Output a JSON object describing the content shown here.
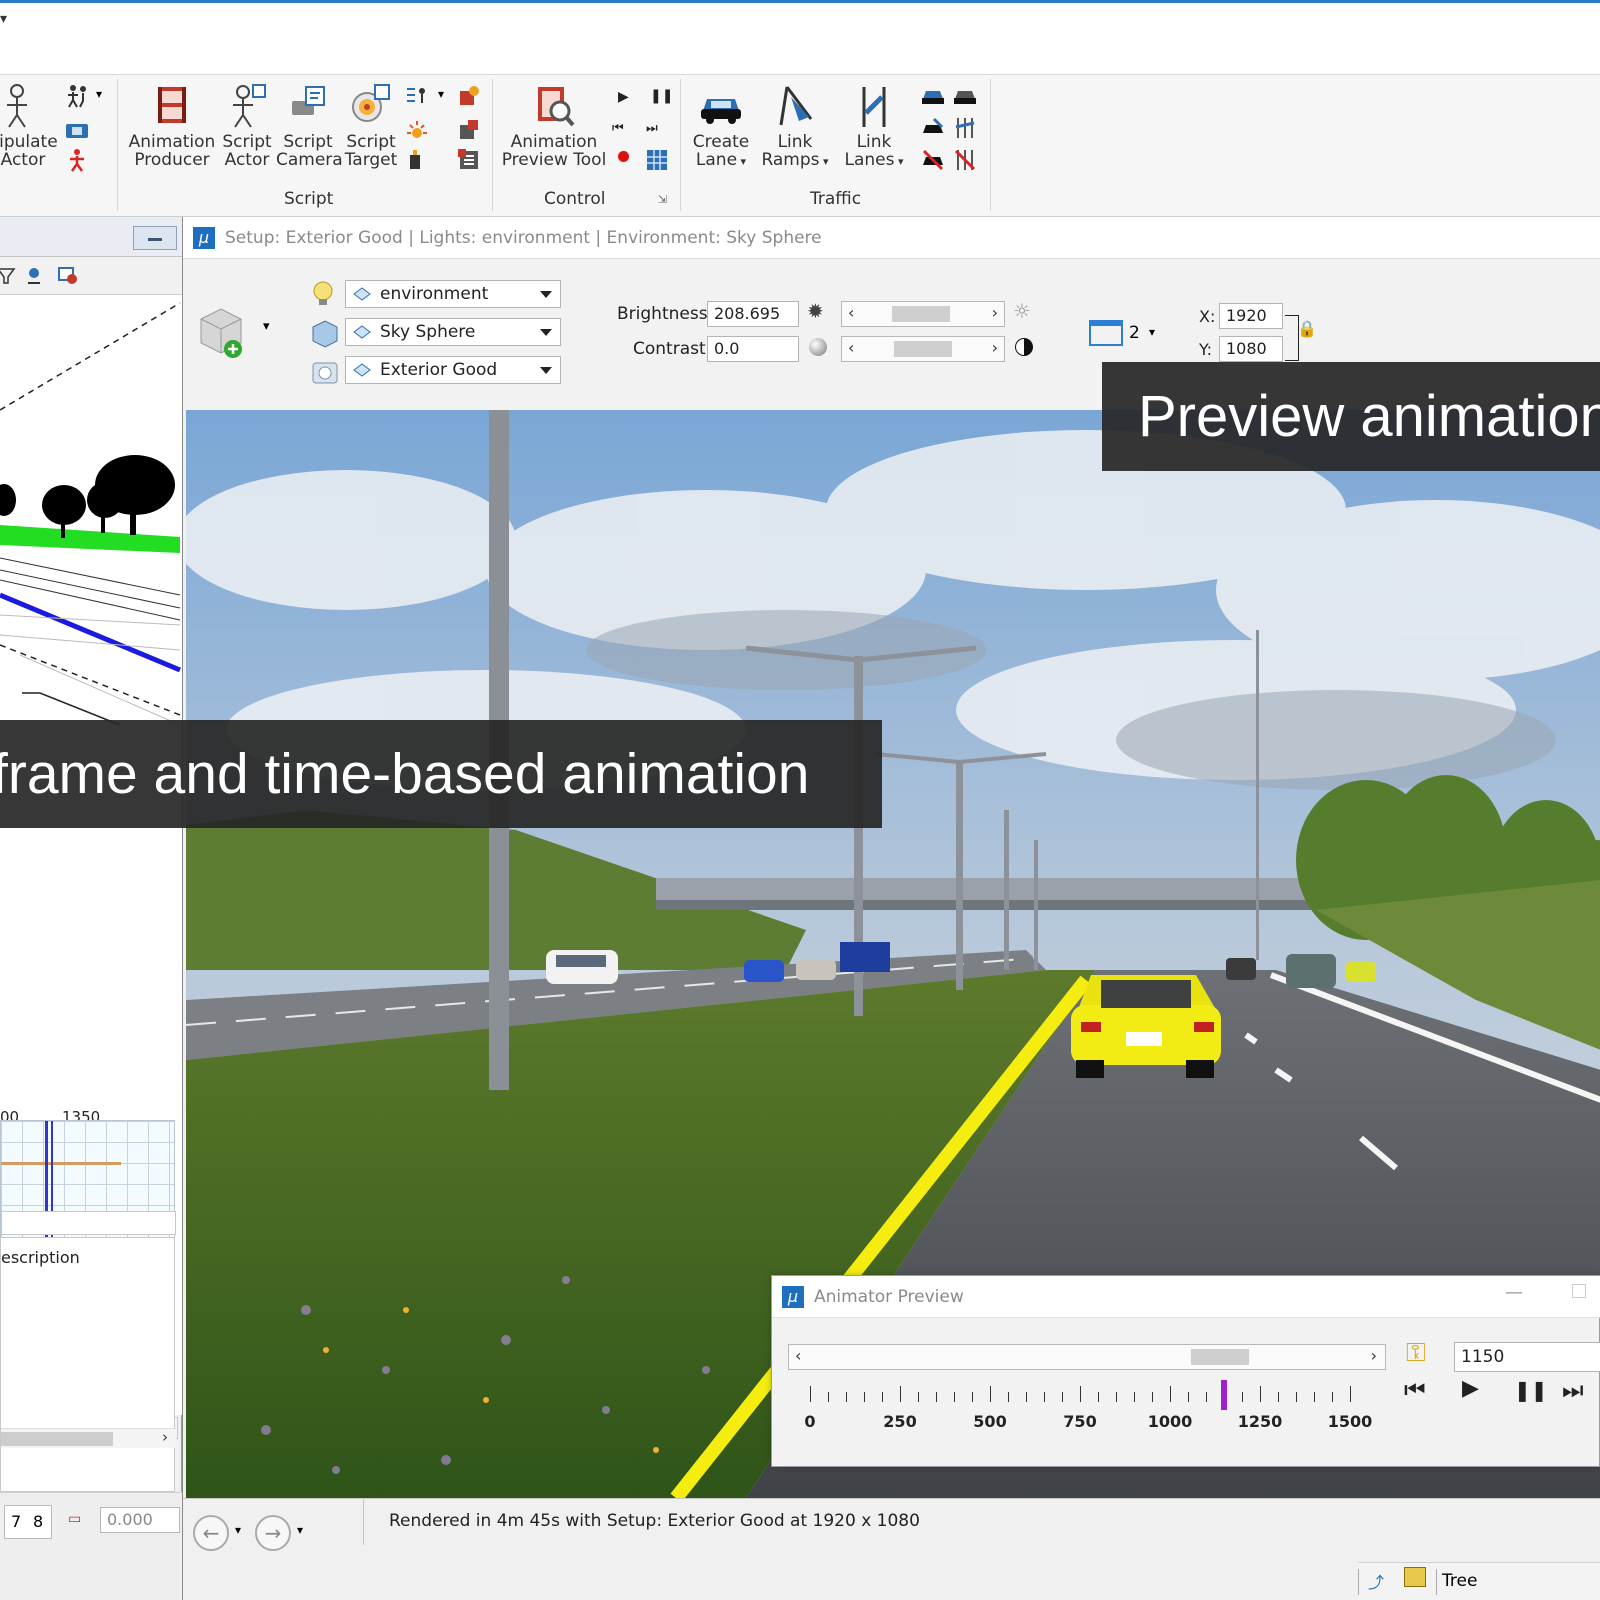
{
  "ribbon": {
    "manipulate_actor": {
      "line1": "nipulate",
      "line2": "Actor"
    },
    "script_group": {
      "label": "Script",
      "animation_producer": {
        "line1": "Animation",
        "line2": "Producer"
      },
      "script_actor": {
        "line1": "Script",
        "line2": "Actor"
      },
      "script_camera": {
        "line1": "Script",
        "line2": "Camera"
      },
      "script_target": {
        "line1": "Script",
        "line2": "Target"
      }
    },
    "control_group": {
      "label": "Control",
      "animation_preview_tool": {
        "line1": "Animation",
        "line2": "Preview Tool"
      }
    },
    "traffic_group": {
      "label": "Traffic",
      "create_lane": {
        "line1": "Create",
        "line2": "Lane"
      },
      "link_ramps": {
        "line1": "Link",
        "line2": "Ramps"
      },
      "link_lanes": {
        "line1": "Link",
        "line2": "Lanes"
      }
    }
  },
  "left_panel": {
    "timeline_labels": [
      "00",
      "1350"
    ],
    "desc_header": "escription",
    "status_tabs": [
      "7",
      "8"
    ],
    "status_value": "0.000"
  },
  "main_window": {
    "title": "Setup: Exterior Good | Lights: environment | Environment: Sky Sphere",
    "lights_dropdown": "environment",
    "environment_dropdown": "Sky Sphere",
    "setup_dropdown": "Exterior Good",
    "brightness_label": "Brightness:",
    "brightness_value": "208.695",
    "contrast_label": "Contrast:",
    "contrast_value": "0.0",
    "view_number": "2",
    "x_label": "X:",
    "x_value": "1920",
    "y_label": "Y:",
    "y_value": "1080",
    "status_text": "Rendered in 4m 45s with Setup: Exterior Good at 1920 x 1080"
  },
  "captions": {
    "top": "Preview animation",
    "middle": "frame and time-based animation"
  },
  "animator_preview": {
    "title": "Animator Preview",
    "frame_value": "1150",
    "tick_labels": [
      "0",
      "250",
      "500",
      "750",
      "1000",
      "1250",
      "1500"
    ],
    "current_frame": 1150,
    "max_frame": 1500
  },
  "bottom_right": {
    "tree_label": "Tree"
  },
  "colors": {
    "accent": "#2b7bc4",
    "marker": "#a020d0",
    "caption_bg": "#262626"
  }
}
